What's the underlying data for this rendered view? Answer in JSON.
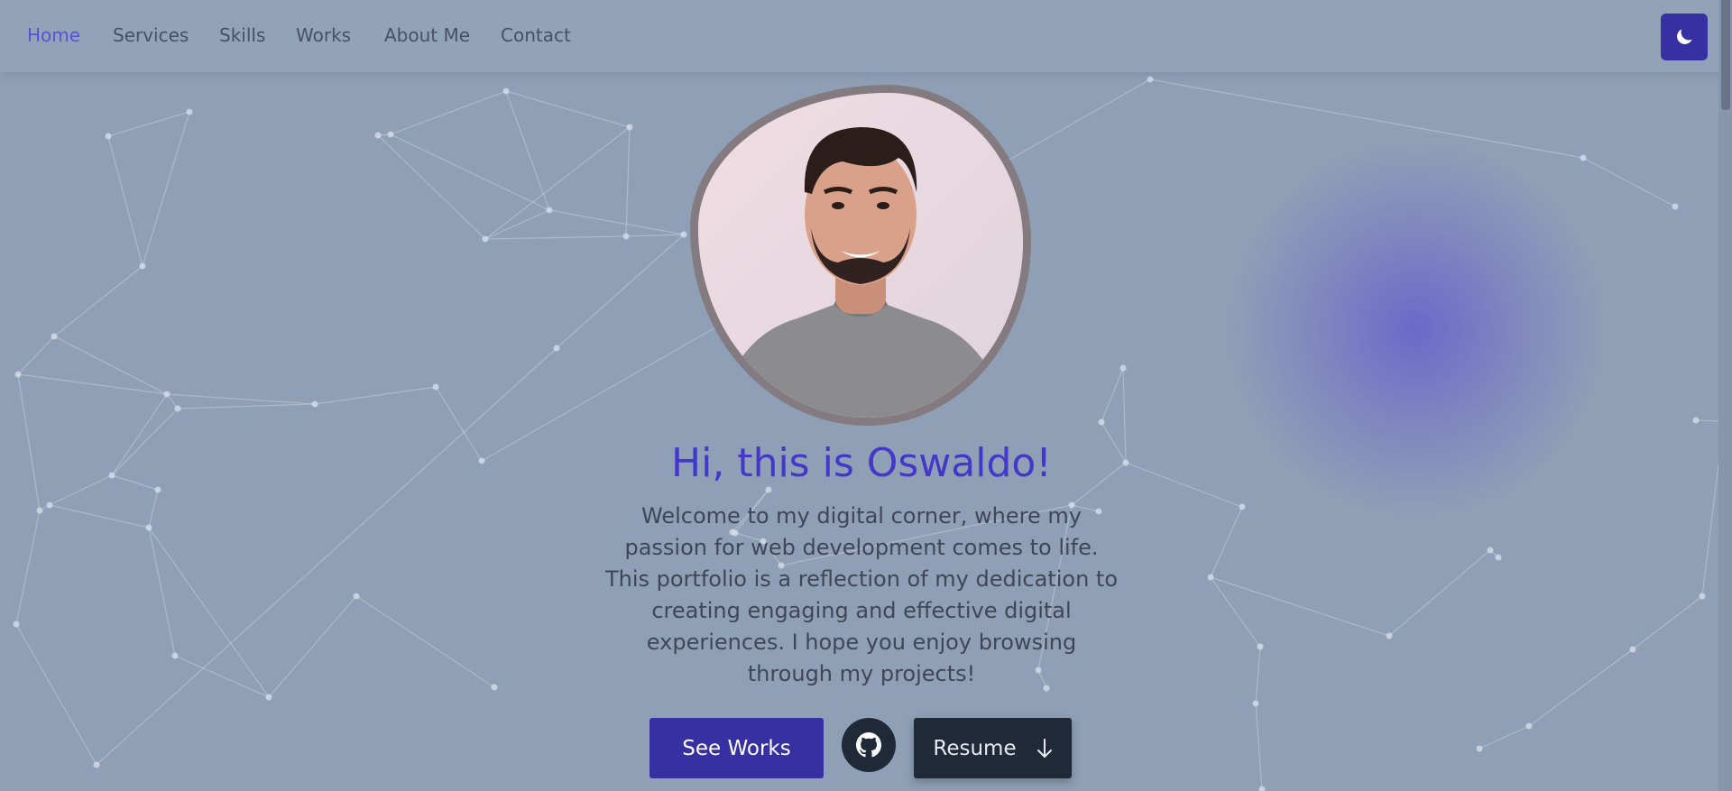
{
  "nav": {
    "items": [
      {
        "label": "Home",
        "active": true
      },
      {
        "label": "Services",
        "active": false
      },
      {
        "label": "Skills",
        "active": false
      },
      {
        "label": "Works",
        "active": false
      },
      {
        "label": "About Me",
        "active": false
      },
      {
        "label": "Contact",
        "active": false
      }
    ],
    "theme_toggle_icon": "moon-icon"
  },
  "hero": {
    "greeting": "Hi, this is Oswaldo!",
    "intro": "Welcome to my digital corner, where my passion for web development comes to life. This portfolio is a reflection of my dedication to creating engaging and effective digital experiences. I hope you enjoy browsing through my projects!",
    "see_works_label": "See Works",
    "github_icon": "github-icon",
    "resume_label": "Resume",
    "resume_icon": "arrow-down-icon"
  },
  "colors": {
    "background": "#8f9fb6",
    "accent": "#4338ca",
    "button_primary": "#3730a3",
    "button_dark": "#1f2937",
    "nav_active": "#5a52d6"
  }
}
